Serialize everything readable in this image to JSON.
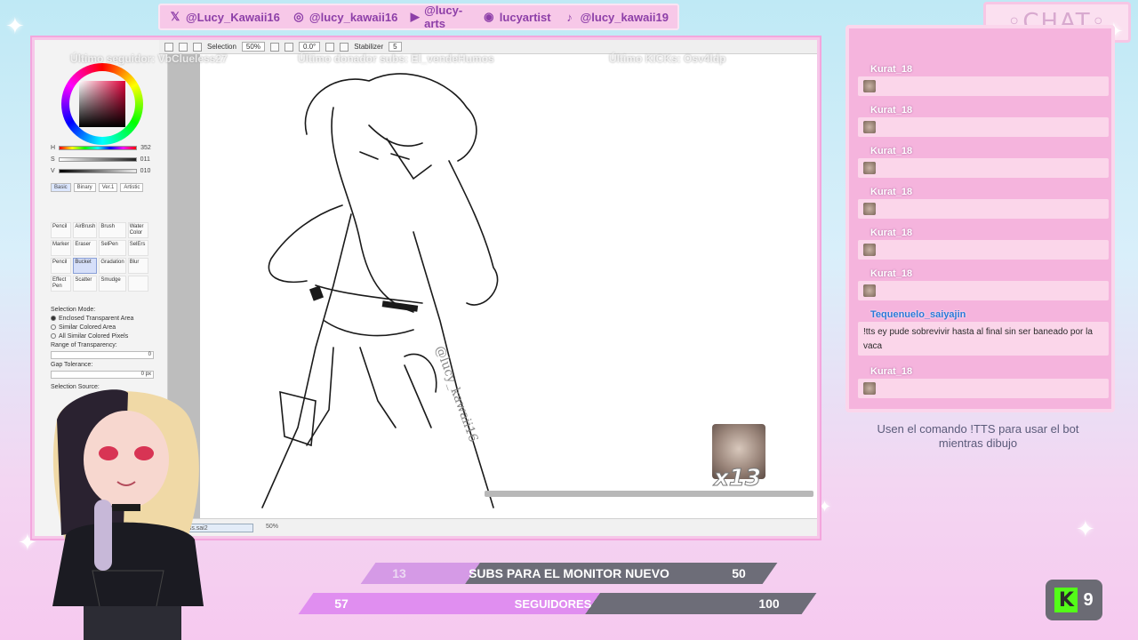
{
  "social": [
    {
      "icon": "x-icon",
      "glyph": "𝕏",
      "handle": "@Lucy_Kawaii16"
    },
    {
      "icon": "instagram-icon",
      "glyph": "◎",
      "handle": "@lucy_kawaii16"
    },
    {
      "icon": "youtube-icon",
      "glyph": "▶",
      "handle": "@lucy-arts"
    },
    {
      "icon": "discord-icon",
      "glyph": "◉",
      "handle": "lucyartist"
    },
    {
      "icon": "tiktok-icon",
      "glyph": "♪",
      "handle": "@lucy_kawaii19"
    }
  ],
  "chat_header": "◦CHAT◦",
  "overlay": {
    "last_follower": "Último seguidor: VbClueless27",
    "last_donor": "Último donador subs: El_vendeHumos",
    "last_kick": "Último KICKs: Osv4ldp"
  },
  "app": {
    "toolbar": {
      "selection_label": "Selection",
      "zoom": "50%",
      "angle": "0.0°",
      "stabilizer_label": "Stabilizer",
      "stabilizer_value": "5"
    },
    "hsv": {
      "h_label": "H",
      "h_value": "352",
      "s_label": "S",
      "s_value": "011",
      "v_label": "V",
      "v_value": "010"
    },
    "tool_tabs": [
      "Basic",
      "Binary",
      "Ver.1",
      "Artistic"
    ],
    "tools": [
      "Pencil",
      "AirBrush",
      "Brush",
      "Water Color",
      "Marker",
      "Eraser",
      "SelPen",
      "SelErs",
      "Pencil",
      "Bucket",
      "Gradation",
      "Blur",
      "Effect Pen",
      "Scatter",
      "Smudge",
      ""
    ],
    "selection_mode_label": "Selection Mode:",
    "selection_modes": [
      "Enclosed Transparent Area",
      "Similar Colored Area",
      "All Similar Colored Pixels"
    ],
    "range_label": "Range of Transparency:",
    "range_value": "0",
    "gap_label": "Gap Tolerance:",
    "gap_value": "0 px",
    "source_label": "Selection Source:",
    "file_tab": "...ss.sai2",
    "status_zoom": "50%"
  },
  "hamster_count": "x13",
  "chat": [
    {
      "user": "Kurat_18",
      "text": "",
      "emote": true
    },
    {
      "user": "Kurat_18",
      "text": "",
      "emote": true
    },
    {
      "user": "Kurat_18",
      "text": "",
      "emote": true
    },
    {
      "user": "Kurat_18",
      "text": "",
      "emote": true
    },
    {
      "user": "Kurat_18",
      "text": "",
      "emote": true
    },
    {
      "user": "Kurat_18",
      "text": "",
      "emote": true
    },
    {
      "user": "Tequenuelo_saiyajin",
      "text": "!tts ey pude sobrevivir hasta al final sin ser baneado por la vaca",
      "emote": false
    },
    {
      "user": "Kurat_18",
      "text": "",
      "emote": true
    }
  ],
  "tts_instructions": "Usen el comando !TTS para usar el bot mientras dibujo",
  "goals": {
    "subs": {
      "current": "13",
      "label": "SUBS PARA EL MONITOR NUEVO",
      "target": "50",
      "progress": 0.26
    },
    "followers": {
      "current": "57",
      "label": "SEGUIDORES",
      "target": "100",
      "progress": 0.57
    }
  },
  "kick": {
    "letter": "K",
    "count": "9"
  }
}
